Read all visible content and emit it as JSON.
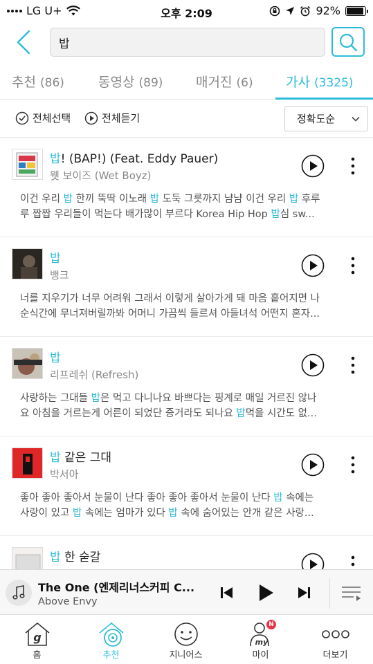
{
  "status_bar": {
    "carrier": "LG U+",
    "time": "오후 2:09",
    "battery": "92%",
    "battery_level": 0.92
  },
  "search": {
    "query": "밥"
  },
  "tabs": [
    {
      "label": "추천",
      "count": "(86)"
    },
    {
      "label": "동영상",
      "count": "(89)"
    },
    {
      "label": "매거진",
      "count": "(6)"
    },
    {
      "label": "가사",
      "count": "(3325)",
      "active": true
    }
  ],
  "toolbar": {
    "select_all": "전체선택",
    "play_all": "전체듣기",
    "sort": "정확도순"
  },
  "results": [
    {
      "title_hl": "밥",
      "title_rest": "! (BAP!) (Feat. Eddy Pauer)",
      "artist": "웻 보이즈 (Wet Boyz)",
      "lyric1": [
        "이건 우리 ",
        "밥",
        " 한끼 뚝딱 이노래 ",
        "밥",
        " 도둑 그릇까지 냠냠 이건 우리 ",
        "밥",
        " 후루"
      ],
      "lyric2": [
        "루 짭짭 우리들이 먹는다 배가많이 부르다 Korea Hip Hop ",
        "밥",
        "심 sw..."
      ]
    },
    {
      "title_hl": "밥",
      "title_rest": "",
      "artist": "뱅크",
      "lyric1": [
        "너를 지우기가 너무 어려워 그래서 이렇게 살아가게 돼 마음 흩어지면 나"
      ],
      "lyric2": [
        "순식간에 무너져버릴까봐 어머니 가끔씩 들르셔 아들녀석 어떤지 혼자..."
      ]
    },
    {
      "title_hl": "밥",
      "title_rest": "",
      "artist": "리프레쉬 (Refresh)",
      "lyric1": [
        "사랑하는 그대들 ",
        "밥",
        "은 먹고 다니나요 바쁘다는 핑계로 매일 거르진 않나"
      ],
      "lyric2": [
        "요 아침을 거르는게 어른이 되었단 증거라도 되나요 ",
        "밥",
        "먹을 시간도 없..."
      ]
    },
    {
      "title_hl": "밥",
      "title_rest": " 같은 그대",
      "artist": "박서아",
      "lyric1": [
        "좋아 좋아 좋아서 눈물이 난다 좋아 좋아 좋아서 눈물이 난다 ",
        "밥",
        " 속에는"
      ],
      "lyric2": [
        "사랑이 있고 ",
        "밥",
        " 속에는 엄마가 있다 ",
        "밥",
        " 속에 숨어있는 안개 같은 사랑..."
      ]
    },
    {
      "title_hl": "밥",
      "title_rest": " 한 숟갈",
      "artist": "",
      "lyric1": [],
      "lyric2": []
    }
  ],
  "player": {
    "title": "The One (엔제리너스커피 C...",
    "artist": "Above Envy"
  },
  "nav": [
    {
      "label": "홈",
      "icon": "home-g-icon"
    },
    {
      "label": "추천",
      "icon": "recommend-disc-icon",
      "active": true
    },
    {
      "label": "지니어스",
      "icon": "smiley-icon"
    },
    {
      "label": "마이",
      "icon": "my-person-icon",
      "badge": "N"
    },
    {
      "label": "더보기",
      "icon": "more-dots-icon"
    }
  ],
  "colors": {
    "accent": "#2cbcd9",
    "badge": "#e8334a"
  }
}
